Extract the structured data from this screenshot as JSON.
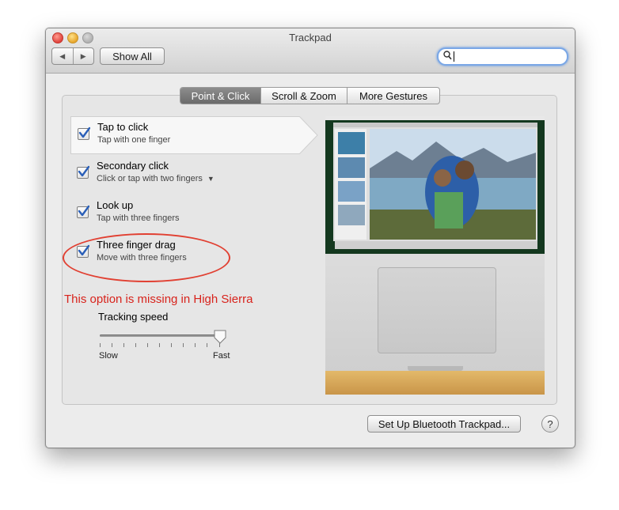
{
  "window": {
    "title": "Trackpad"
  },
  "toolbar": {
    "back_icon": "back-arrow-icon",
    "forward_icon": "forward-arrow-icon",
    "show_all_label": "Show All",
    "search_value": ""
  },
  "tabs": [
    {
      "label": "Point & Click",
      "active": true
    },
    {
      "label": "Scroll & Zoom",
      "active": false
    },
    {
      "label": "More Gestures",
      "active": false
    }
  ],
  "options": [
    {
      "title": "Tap to click",
      "subtitle": "Tap with one finger",
      "checked": true,
      "selected": true
    },
    {
      "title": "Secondary click",
      "subtitle": "Click or tap with two fingers",
      "checked": true,
      "has_dropdown": true
    },
    {
      "title": "Look up",
      "subtitle": "Tap with three fingers",
      "checked": true
    },
    {
      "title": "Three finger drag",
      "subtitle": "Move with three fingers",
      "checked": true
    }
  ],
  "annotation": {
    "text": "This option is missing in High Sierra",
    "color": "#d8231c"
  },
  "tracking": {
    "label": "Tracking speed",
    "slow_label": "Slow",
    "fast_label": "Fast",
    "value_fraction": 1.0
  },
  "buttons": {
    "bluetooth_label": "Set Up Bluetooth Trackpad...",
    "help_label": "?"
  },
  "colors": {
    "check": "#2a5fb8",
    "selected_tab": "#7a7a7a"
  }
}
